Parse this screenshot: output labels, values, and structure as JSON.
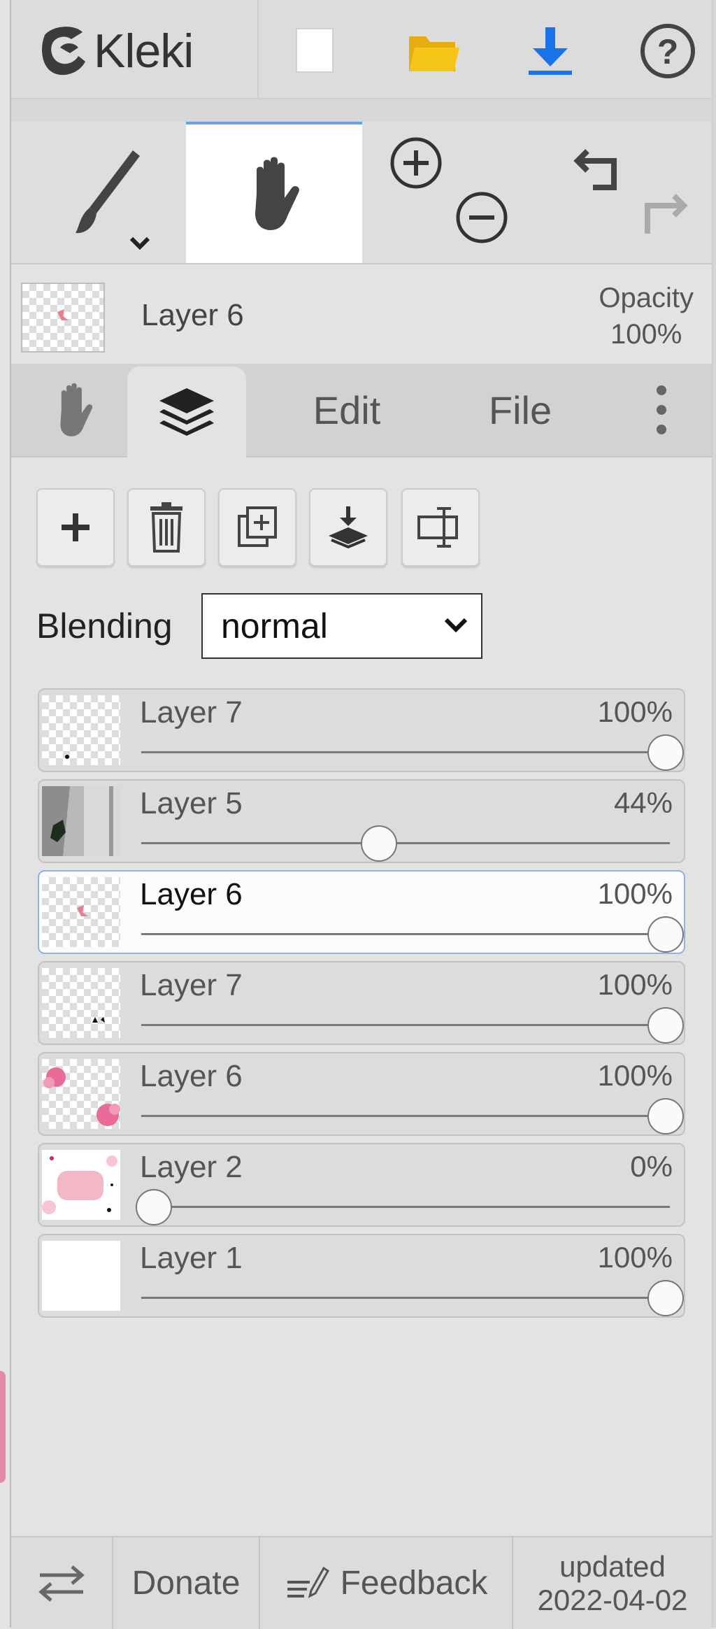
{
  "app": {
    "logo_text": "Kleki"
  },
  "current_layer": {
    "name": "Layer 6",
    "opacity_label": "Opacity",
    "opacity_value": "100%"
  },
  "tabs": {
    "edit": "Edit",
    "file": "File"
  },
  "blending": {
    "label": "Blending",
    "value": "normal"
  },
  "layers": [
    {
      "name": "Layer 7",
      "opacity": "100%",
      "opacity_value": 1.0
    },
    {
      "name": "Layer 5",
      "opacity": "44%",
      "opacity_value": 0.44
    },
    {
      "name": "Layer 6",
      "opacity": "100%",
      "opacity_value": 1.0,
      "selected": true
    },
    {
      "name": "Layer 7",
      "opacity": "100%",
      "opacity_value": 1.0
    },
    {
      "name": "Layer 6",
      "opacity": "100%",
      "opacity_value": 1.0
    },
    {
      "name": "Layer 2",
      "opacity": "0%",
      "opacity_value": 0.0
    },
    {
      "name": "Layer 1",
      "opacity": "100%",
      "opacity_value": 1.0
    }
  ],
  "footer": {
    "donate": "Donate",
    "feedback": "Feedback",
    "updated_label": "updated",
    "updated_date": "2022-04-02"
  },
  "colors": {
    "accent_blue": "#1a73e8",
    "folder_yellow": "#f5c518",
    "selected_border": "#8fb2e3"
  },
  "icons": [
    "new-file-icon",
    "open-folder-icon",
    "download-icon",
    "help-icon",
    "brush-icon",
    "hand-icon",
    "zoom-in-icon",
    "zoom-out-icon",
    "undo-icon",
    "redo-icon",
    "layers-icon",
    "more-vertical-icon",
    "add-layer-icon",
    "delete-layer-icon",
    "duplicate-layer-icon",
    "merge-down-icon",
    "rename-layer-icon",
    "swap-icon",
    "feedback-icon"
  ]
}
